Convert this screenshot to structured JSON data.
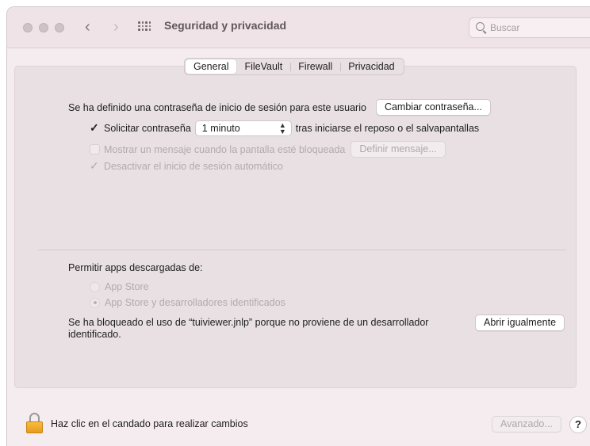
{
  "window": {
    "title": "Seguridad y privacidad",
    "back_glyph": "‹",
    "forward_glyph": "›"
  },
  "search": {
    "placeholder": "Buscar",
    "value": ""
  },
  "tabs": [
    {
      "label": "General",
      "active": true
    },
    {
      "label": "FileVault",
      "active": false
    },
    {
      "label": "Firewall",
      "active": false
    },
    {
      "label": "Privacidad",
      "active": false
    }
  ],
  "general": {
    "password_set_text": "Se ha definido una contraseña de inicio de sesión para este usuario",
    "change_password_button": "Cambiar contraseña...",
    "require_password_label": "Solicitar contraseña",
    "require_password_checked": true,
    "require_password_delay": "1 minuto",
    "require_password_suffix": "tras iniciarse el reposo o el salvapantallas",
    "show_message_label": "Mostrar un mensaje cuando la pantalla esté bloqueada",
    "show_message_checked": false,
    "set_message_button": "Definir mensaje...",
    "disable_autologin_label": "Desactivar el inicio de sesión automático",
    "disable_autologin_checked": true
  },
  "downloads": {
    "heading": "Permitir apps descargadas de:",
    "options": [
      {
        "label": "App Store",
        "selected": false
      },
      {
        "label": "App Store y desarrolladores identificados",
        "selected": true
      }
    ],
    "blocked_line1": "Se ha bloqueado el uso de “tuiviewer.jnlp” porque no proviene de un desarrollador",
    "blocked_line2": "identificado.",
    "open_anyway_button": "Abrir igualmente"
  },
  "footer": {
    "lock_text": "Haz clic en el candado para realizar cambios",
    "advanced_button": "Avanzado...",
    "help_label": "?"
  },
  "colors": {
    "window_bg": "#f5ecef",
    "panel_bg": "#e8e0e3",
    "lock_gold": "#f0ab2b"
  },
  "icons": [
    "back-icon",
    "forward-icon",
    "grid-icon",
    "search-icon",
    "lock-icon",
    "checkmark-icon",
    "chevron-updown-icon",
    "help-icon"
  ]
}
